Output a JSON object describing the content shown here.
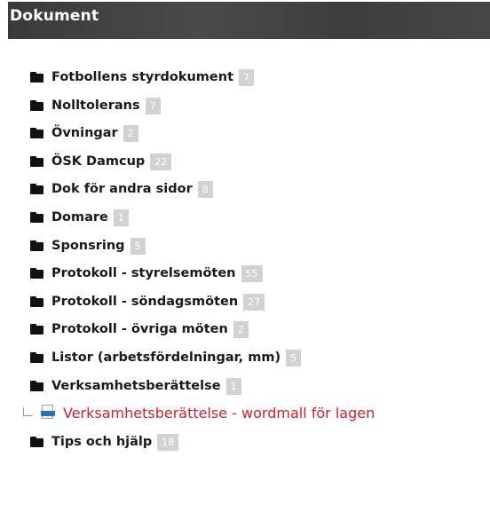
{
  "header": {
    "title": "Dokument"
  },
  "folders": [
    {
      "label": "Fotbollens styrdokument",
      "count": "7"
    },
    {
      "label": "Nolltolerans",
      "count": "7"
    },
    {
      "label": "Övningar",
      "count": "2"
    },
    {
      "label": "ÖSK Damcup",
      "count": "22"
    },
    {
      "label": "Dok för andra sidor",
      "count": "8"
    },
    {
      "label": "Domare",
      "count": "1"
    },
    {
      "label": "Sponsring",
      "count": "5"
    },
    {
      "label": "Protokoll - styrelsemöten",
      "count": "55"
    },
    {
      "label": "Protokoll - söndagsmöten",
      "count": "27"
    },
    {
      "label": "Protokoll - övriga möten",
      "count": "2"
    },
    {
      "label": "Listor (arbetsfördelningar, mm)",
      "count": "5"
    },
    {
      "label": "Verksamhetsberättelse",
      "count": "1"
    }
  ],
  "expanded_file": {
    "label": "Verksamhetsberättelse - wordmall för lagen",
    "icon": "word-document-icon",
    "color": "#d41f2a"
  },
  "last_folder": {
    "label": "Tips och hjälp",
    "count": "18"
  },
  "colors": {
    "header_bg": "#404040",
    "badge_bg": "#d2d2d2",
    "link": "#d41f2a"
  }
}
